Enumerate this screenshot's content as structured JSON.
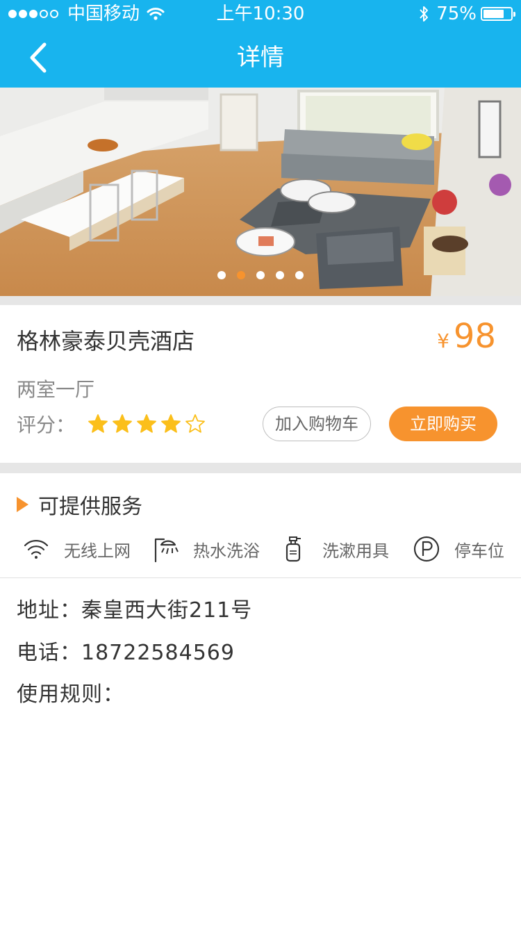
{
  "status_bar": {
    "carrier": "中国移动",
    "time": "上午10:30",
    "battery": "75%",
    "battery_level": 0.75
  },
  "nav": {
    "title": "详情",
    "back_icon": "chevron-left-icon"
  },
  "carousel": {
    "slides": 5,
    "active_index": 1
  },
  "hotel": {
    "name": "格林豪泰贝壳酒店",
    "currency": "¥",
    "price": "98",
    "room_type": "两室一厅",
    "rating_label": "评分：",
    "rating": 4,
    "rating_max": 5
  },
  "actions": {
    "cart_label": "加入购物车",
    "buy_label": "立即购买"
  },
  "services": {
    "title": "可提供服务",
    "items": [
      {
        "icon": "wifi-icon",
        "label": "无线上网"
      },
      {
        "icon": "shower-icon",
        "label": "热水洗浴"
      },
      {
        "icon": "toiletries-icon",
        "label": "洗漱用具"
      },
      {
        "icon": "parking-icon",
        "label": "停车位"
      }
    ]
  },
  "details": {
    "address": "地址：秦皇西大街211号",
    "phone": "电话：18722584569",
    "rules": "使用规则："
  },
  "colors": {
    "header": "#18b4ee",
    "accent": "#f7932e",
    "star": "#fbbf1b"
  }
}
